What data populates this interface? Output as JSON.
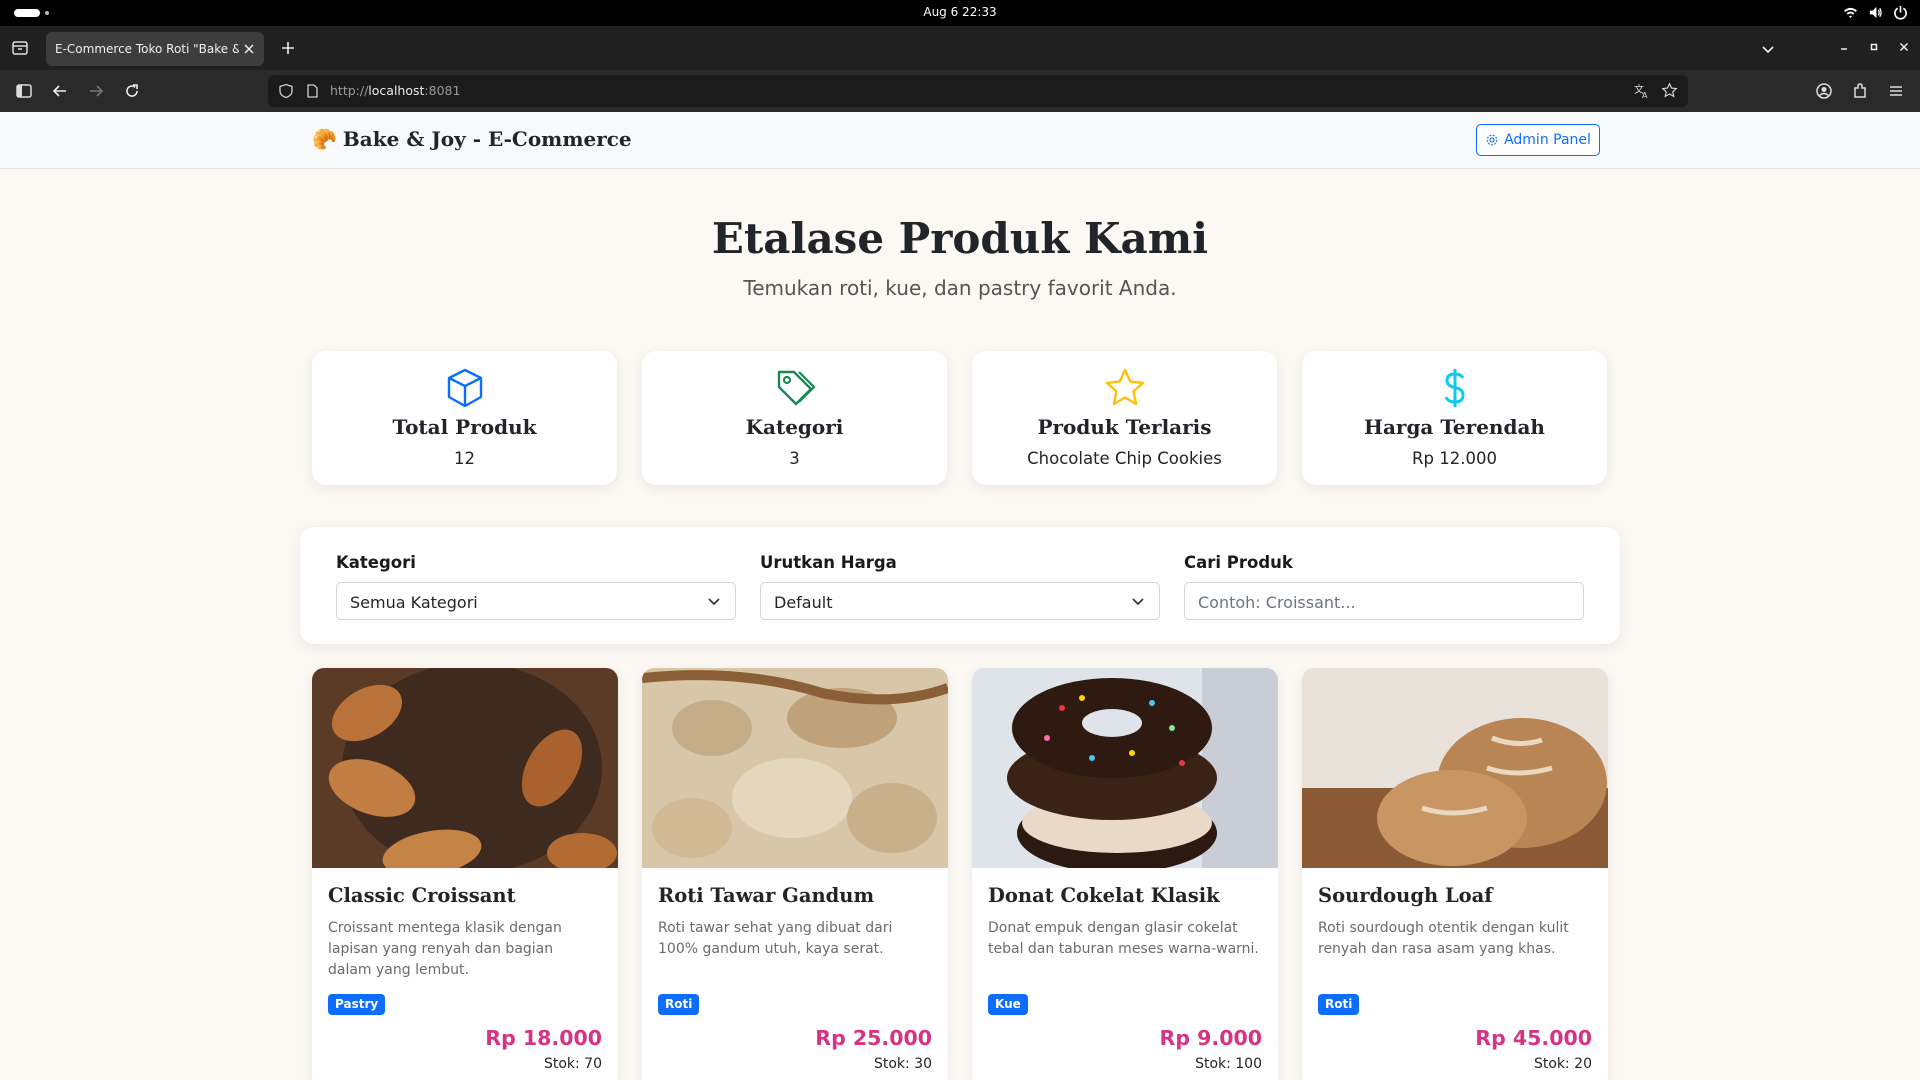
{
  "os": {
    "clock": "Aug 6  22:33"
  },
  "browser": {
    "tab_title": "E-Commerce Toko Roti \"Bake & Joy\"",
    "url_scheme": "http://",
    "url_host": "localhost",
    "url_port": ":8081"
  },
  "site": {
    "brand_emoji": "🥐",
    "brand": "Bake & Joy - E-Commerce",
    "admin_label": "Admin Panel"
  },
  "hero": {
    "title": "Etalase Produk Kami",
    "subtitle": "Temukan roti, kue, dan pastry favorit Anda."
  },
  "stats": [
    {
      "icon": "box-icon",
      "label": "Total Produk",
      "value": "12",
      "color": "#0d6efd"
    },
    {
      "icon": "tag-icon",
      "label": "Kategori",
      "value": "3",
      "color": "#198754"
    },
    {
      "icon": "star-icon",
      "label": "Produk Terlaris",
      "value": "Chocolate Chip Cookies",
      "color": "#ffc107"
    },
    {
      "icon": "dollar-icon",
      "label": "Harga Terendah",
      "value": "Rp 12.000",
      "color": "#0dcaf0"
    }
  ],
  "filters": {
    "category_label": "Kategori",
    "category_value": "Semua Kategori",
    "sort_label": "Urutkan Harga",
    "sort_value": "Default",
    "search_label": "Cari Produk",
    "search_placeholder": "Contoh: Croissant..."
  },
  "products": [
    {
      "name": "Classic Croissant",
      "desc": "Croissant mentega klasik dengan lapisan yang renyah dan bagian dalam yang lembut.",
      "category": "Pastry",
      "price": "Rp 18.000",
      "stock": "Stok: 70"
    },
    {
      "name": "Roti Tawar Gandum",
      "desc": "Roti tawar sehat yang dibuat dari 100% gandum utuh, kaya serat.",
      "category": "Roti",
      "price": "Rp 25.000",
      "stock": "Stok: 30"
    },
    {
      "name": "Donat Cokelat Klasik",
      "desc": "Donat empuk dengan glasir cokelat tebal dan taburan meses warna-warni.",
      "category": "Kue",
      "price": "Rp 9.000",
      "stock": "Stok: 100"
    },
    {
      "name": "Sourdough Loaf",
      "desc": "Roti sourdough otentik dengan kulit renyah dan rasa asam yang khas.",
      "category": "Roti",
      "price": "Rp 45.000",
      "stock": "Stok: 20"
    }
  ],
  "colors": {
    "accent": "#0d6efd",
    "price": "#d63384",
    "page_bg": "#fcf9f5"
  }
}
